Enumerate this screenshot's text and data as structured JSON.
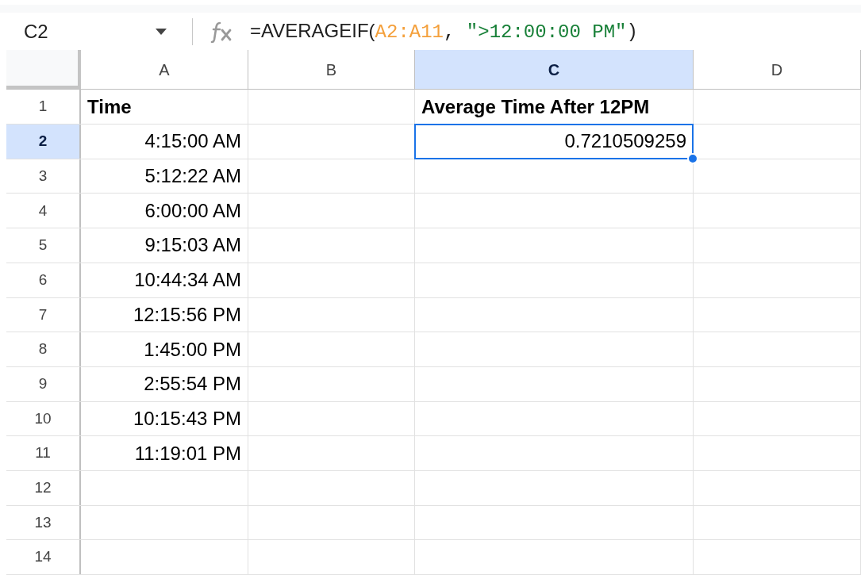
{
  "name_box": {
    "value": "C2"
  },
  "formula": [
    {
      "kind": "plain",
      "text": "=AVERAGEIF("
    },
    {
      "kind": "range",
      "text": "A2:A11"
    },
    {
      "kind": "plain",
      "text": ", "
    },
    {
      "kind": "string",
      "text": "\">12:00:00 PM\""
    },
    {
      "kind": "plain",
      "text": ")"
    }
  ],
  "columns": [
    {
      "label": "A",
      "selected": false
    },
    {
      "label": "B",
      "selected": false
    },
    {
      "label": "C",
      "selected": true
    },
    {
      "label": "D",
      "selected": false
    }
  ],
  "rows": [
    {
      "number": "1",
      "selected": false,
      "cells": [
        {
          "value": "Time",
          "kind": "text",
          "bold": true,
          "selected": false
        },
        null,
        {
          "value": "Average Time After 12PM",
          "kind": "text",
          "bold": true,
          "selected": false
        },
        null
      ]
    },
    {
      "number": "2",
      "selected": true,
      "cells": [
        {
          "value": "4:15:00 AM",
          "kind": "number",
          "bold": false,
          "selected": false
        },
        null,
        {
          "value": "0.7210509259",
          "kind": "number",
          "bold": false,
          "selected": true
        },
        null
      ]
    },
    {
      "number": "3",
      "selected": false,
      "cells": [
        {
          "value": "5:12:22 AM",
          "kind": "number",
          "bold": false,
          "selected": false
        }
      ]
    },
    {
      "number": "4",
      "selected": false,
      "cells": [
        {
          "value": "6:00:00 AM",
          "kind": "number",
          "bold": false,
          "selected": false
        }
      ]
    },
    {
      "number": "5",
      "selected": false,
      "cells": [
        {
          "value": "9:15:03 AM",
          "kind": "number",
          "bold": false,
          "selected": false
        }
      ]
    },
    {
      "number": "6",
      "selected": false,
      "cells": [
        {
          "value": "10:44:34 AM",
          "kind": "number",
          "bold": false,
          "selected": false
        }
      ]
    },
    {
      "number": "7",
      "selected": false,
      "cells": [
        {
          "value": "12:15:56 PM",
          "kind": "number",
          "bold": false,
          "selected": false
        }
      ]
    },
    {
      "number": "8",
      "selected": false,
      "cells": [
        {
          "value": "1:45:00 PM",
          "kind": "number",
          "bold": false,
          "selected": false
        }
      ]
    },
    {
      "number": "9",
      "selected": false,
      "cells": [
        {
          "value": "2:55:54 PM",
          "kind": "number",
          "bold": false,
          "selected": false
        }
      ]
    },
    {
      "number": "10",
      "selected": false,
      "cells": [
        {
          "value": "10:15:43 PM",
          "kind": "number",
          "bold": false,
          "selected": false
        }
      ]
    },
    {
      "number": "11",
      "selected": false,
      "cells": [
        {
          "value": "11:19:01 PM",
          "kind": "number",
          "bold": false,
          "selected": false
        }
      ]
    },
    {
      "number": "12",
      "selected": false
    },
    {
      "number": "13",
      "selected": false
    },
    {
      "number": "14",
      "selected": false
    }
  ]
}
